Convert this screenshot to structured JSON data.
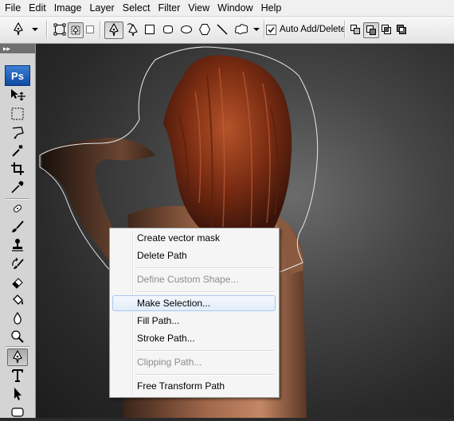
{
  "menubar": {
    "items": [
      "File",
      "Edit",
      "Image",
      "Layer",
      "Select",
      "Filter",
      "View",
      "Window",
      "Help"
    ]
  },
  "options_bar": {
    "tool_preset_icon": "pen-icon",
    "mode_icons": [
      "shape-layers-icon",
      "paths-icon",
      "fill-pixels-icon"
    ],
    "tool_icons": [
      "pen-icon",
      "freeform-pen-icon",
      "rectangle-icon",
      "rounded-rectangle-icon",
      "ellipse-icon",
      "polygon-icon",
      "line-icon",
      "custom-shape-icon"
    ],
    "auto_add_delete": {
      "label": "Auto Add/Delete",
      "checked": true
    },
    "combine_icons": [
      "add-to-path-icon",
      "subtract-from-path-icon",
      "intersect-path-icon",
      "exclude-overlap-icon"
    ]
  },
  "toolbox": {
    "logo": "Ps",
    "tools": [
      "move-tool-icon",
      "marquee-tool-icon",
      "lasso-tool-icon",
      "magic-wand-icon",
      "crop-tool-icon",
      "eyedropper-icon",
      "healing-brush-icon",
      "brush-tool-icon",
      "clone-stamp-icon",
      "history-brush-icon",
      "eraser-icon",
      "paint-bucket-icon",
      "blur-tool-icon",
      "dodge-tool-icon",
      "pen-tool-icon",
      "type-tool-icon",
      "path-selection-icon",
      "shape-tool-icon"
    ],
    "active_tool": "pen-tool-icon"
  },
  "context_menu": {
    "items": [
      {
        "label": "Create vector mask",
        "enabled": true
      },
      {
        "label": "Delete Path",
        "enabled": true
      },
      {
        "label": "Define Custom Shape...",
        "enabled": false
      },
      {
        "label": "Make Selection...",
        "enabled": true,
        "highlighted": true
      },
      {
        "label": "Fill Path...",
        "enabled": true
      },
      {
        "label": "Stroke Path...",
        "enabled": true
      },
      {
        "label": "Clipping Path...",
        "enabled": false
      },
      {
        "label": "Free Transform Path",
        "enabled": true
      }
    ]
  },
  "colors": {
    "menu_highlight_border": "#a8c8ef",
    "ps_logo": "#1d5bb5",
    "hair": "#8a3a1a",
    "skin": "#b87a5a"
  }
}
